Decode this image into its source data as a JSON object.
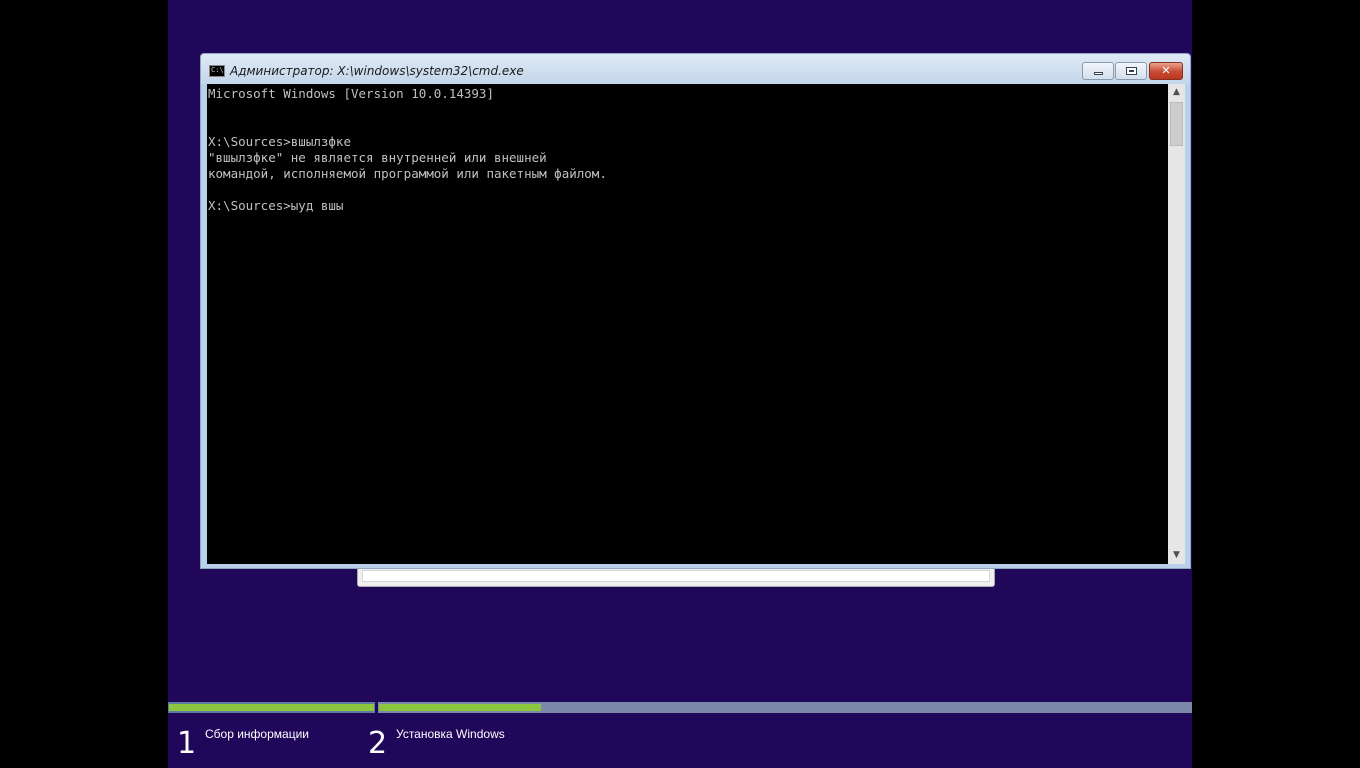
{
  "window": {
    "title": "Администратор: X:\\windows\\system32\\cmd.exe",
    "icon": "cmd-icon",
    "icon_text": "C:\\",
    "buttons": [
      "minimize-icon",
      "restore-icon",
      "close-icon"
    ],
    "close_glyph": "✕"
  },
  "console": {
    "text": "Microsoft Windows [Version 10.0.14393]\n\n\nX:\\Sources>вшылзфке\n\"вшылзфке\" не является внутренней или внешней\nкомандой, исполняемой программой или пакетным файлом.\n\nX:\\Sources>ыуд вшы"
  },
  "scrollbar": {
    "up_glyph": "▲",
    "down_glyph": "▼"
  },
  "setup_progress": {
    "steps": [
      {
        "number": "1",
        "label": "Сбор информации",
        "progress": 1.0
      },
      {
        "number": "2",
        "label": "Установка Windows",
        "progress": 0.2
      }
    ]
  },
  "colors": {
    "background": "#20075a",
    "progress_fill": "#8cc63f",
    "progress_track": "#7c88a9",
    "console_bg": "#000000",
    "console_text": "#c0c0c0"
  }
}
